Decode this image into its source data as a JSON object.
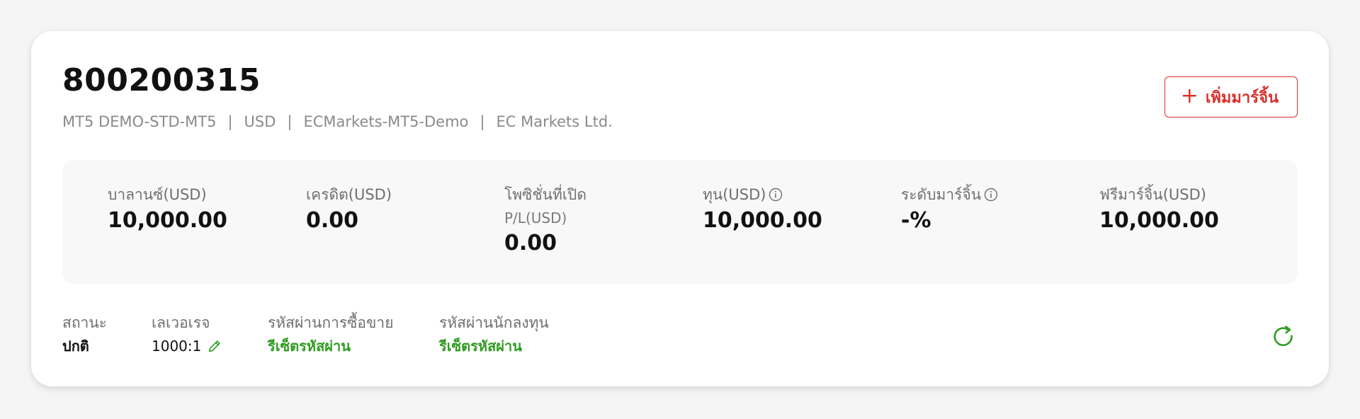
{
  "account": {
    "number": "800200315",
    "type": "MT5 DEMO-STD-MT5",
    "currency": "USD",
    "server": "ECMarkets-MT5-Demo",
    "company": "EC Markets Ltd.",
    "separator": "|"
  },
  "actions": {
    "add_margin_label": "เพิ่มมาร์จิ้น",
    "plus_symbol": "+"
  },
  "stats": [
    {
      "label": "บาลานซ์(USD)",
      "value": "10,000.00"
    },
    {
      "label": "เครดิต(USD)",
      "value": "0.00"
    },
    {
      "label": "โพซิชั่นที่เปิด",
      "sublabel": "P/L(USD)",
      "value": "0.00"
    },
    {
      "label": "ทุน(USD)",
      "value": "10,000.00",
      "info": true
    },
    {
      "label": "ระดับมาร์จิ้น",
      "value": "-%",
      "info": true
    },
    {
      "label": "ฟรีมาร์จิ้น(USD)",
      "value": "10,000.00"
    }
  ],
  "details": {
    "status": {
      "label": "สถานะ",
      "value": "ปกติ"
    },
    "leverage": {
      "label": "เลเวอเรจ",
      "value": "1000:1"
    },
    "trading_password": {
      "label": "รหัสผ่านการซื้อขาย",
      "link": "รีเซ็ตรหัสผ่าน"
    },
    "investor_password": {
      "label": "รหัสผ่านนักลงทุน",
      "link": "รีเซ็ตรหัสผ่าน"
    }
  },
  "colors": {
    "accent_red": "#d9302c",
    "accent_green": "#2f9c22",
    "panel_bg": "#f8f8f8",
    "page_bg": "#f5f5f5"
  },
  "icons": {
    "plus": "plus-icon",
    "info": "info-icon",
    "edit": "pencil-icon",
    "refresh": "refresh-icon"
  }
}
